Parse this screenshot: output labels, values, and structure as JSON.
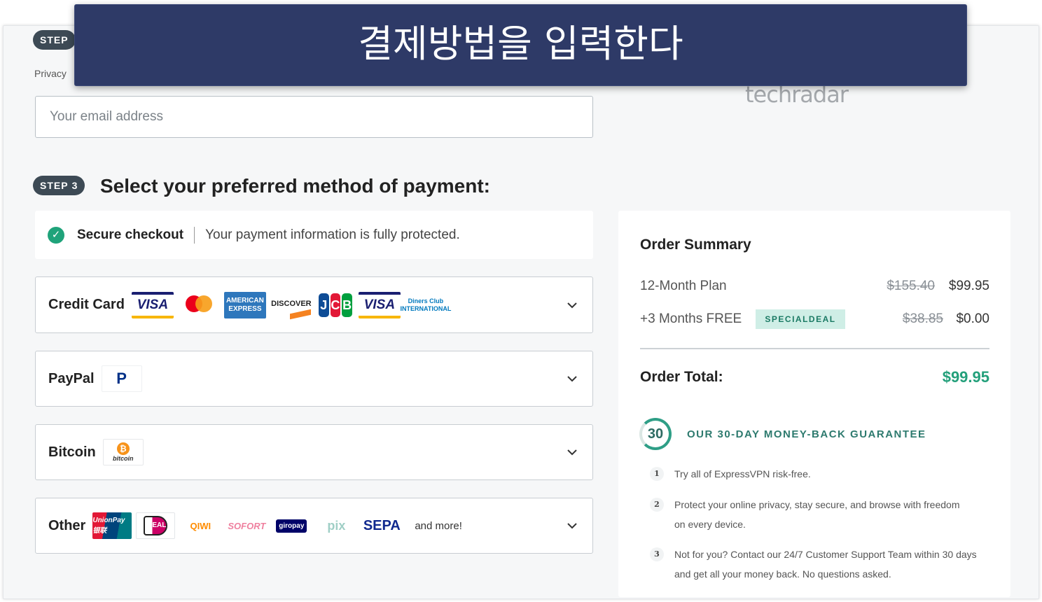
{
  "banner": {
    "text": "결제방법을 입력한다"
  },
  "step2": {
    "label": "STEP",
    "privacy_note": "Privacy"
  },
  "email": {
    "placeholder": "Your email address"
  },
  "brand": {
    "logo_text": "techradar"
  },
  "step3": {
    "label": "STEP",
    "number": "3",
    "title": "Select your preferred method of payment:"
  },
  "secure": {
    "label": "Secure checkout",
    "text": "Your payment information is fully protected."
  },
  "payment_methods": [
    {
      "label": "Credit Card",
      "logos": [
        "VISA",
        "mastercard",
        "AMERICAN EXPRESS",
        "DISCOVER",
        "JCB",
        "VISA",
        "Diners Club INTERNATIONAL"
      ]
    },
    {
      "label": "PayPal",
      "logos": [
        "PayPal"
      ]
    },
    {
      "label": "Bitcoin",
      "logos": [
        "bitcoin"
      ]
    },
    {
      "label": "Other",
      "logos": [
        "UnionPay 银联",
        "iDEAL",
        "QIWI",
        "SOFORT",
        "giropay",
        "pix",
        "SEPA"
      ],
      "extra": "and more!"
    }
  ],
  "summary": {
    "title": "Order Summary",
    "lines": [
      {
        "label": "12-Month Plan",
        "original": "$155.40",
        "price": "$99.95"
      },
      {
        "label": "+3 Months FREE",
        "badge": "SPECIALDEAL",
        "original": "$38.85",
        "price": "$0.00"
      }
    ],
    "total_label": "Order Total:",
    "total_value": "$99.95",
    "guarantee_badge": "30",
    "guarantee_title": "OUR 30-DAY MONEY-BACK GUARANTEE",
    "guarantee_points": [
      {
        "num": "1",
        "text": "Try all of ExpressVPN risk-free."
      },
      {
        "num": "2",
        "text": "Protect your online privacy, stay secure, and browse with freedom on every device."
      },
      {
        "num": "3",
        "text": "Not for you? Contact our 24/7 Customer Support Team within 30 days and get all your money back. No questions asked."
      }
    ]
  },
  "colors": {
    "accent_green": "#24a07b",
    "banner_bg": "#2e3a67",
    "step_pill": "#3d4a55"
  }
}
